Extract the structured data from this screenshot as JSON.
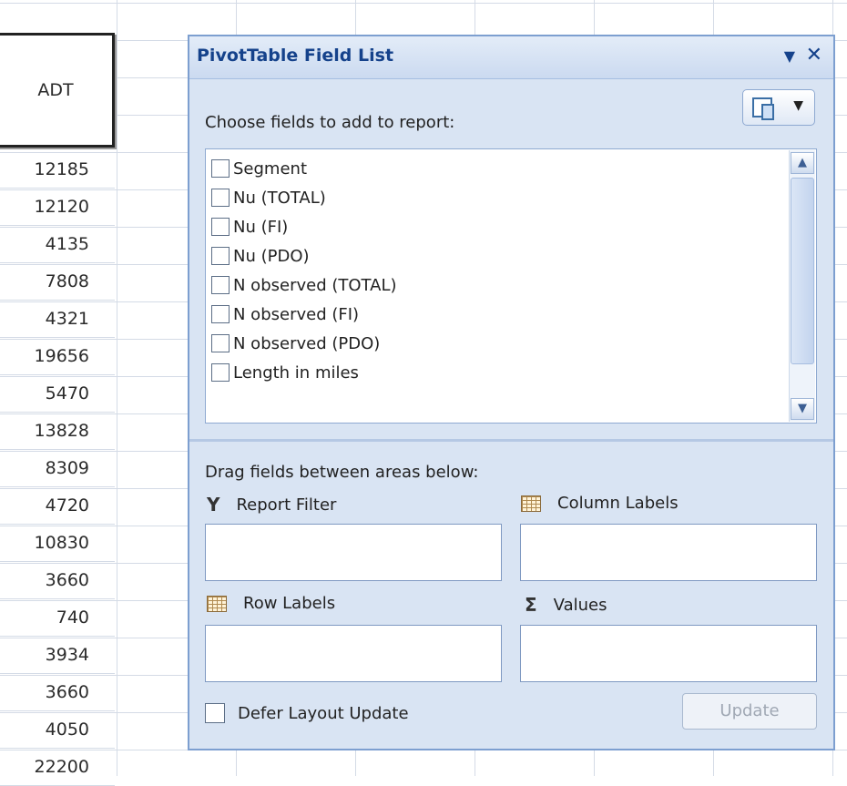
{
  "sheet": {
    "column_header": "ADT",
    "values": [
      "12185",
      "12120",
      "4135",
      "7808",
      "4321",
      "19656",
      "5470",
      "13828",
      "8309",
      "4720",
      "10830",
      "3660",
      "740",
      "3934",
      "3660",
      "4050",
      "22200"
    ]
  },
  "panel": {
    "title": "PivotTable Field List",
    "dropdown_glyph": "▼",
    "close_glyph": "✕",
    "view_caret": "▼",
    "choose_label": "Choose fields to add to report:",
    "fields": [
      {
        "label": "Segment",
        "checked": false
      },
      {
        "label": "Nu (TOTAL)",
        "checked": false
      },
      {
        "label": " Nu (FI)",
        "checked": false
      },
      {
        "label": " Nu (PDO)",
        "checked": false
      },
      {
        "label": "N observed (TOTAL)",
        "checked": false
      },
      {
        "label": " N observed (FI)",
        "checked": false
      },
      {
        "label": " N observed (PDO)",
        "checked": false
      },
      {
        "label": "Length in miles",
        "checked": false
      }
    ],
    "scroll_up": "▲",
    "scroll_down": "▼",
    "drag_label": "Drag fields between areas below:",
    "areas": {
      "report_filter": "Report Filter",
      "column_labels": "Column Labels",
      "row_labels": "Row Labels",
      "values": "Values"
    },
    "filter_glyph": "Y",
    "sigma_glyph": "Σ",
    "defer_label": "Defer Layout Update",
    "update_label": "Update"
  },
  "colors": {
    "panel_bg": "#d9e4f3",
    "title_text": "#15428b",
    "border": "#7d9fd0"
  }
}
